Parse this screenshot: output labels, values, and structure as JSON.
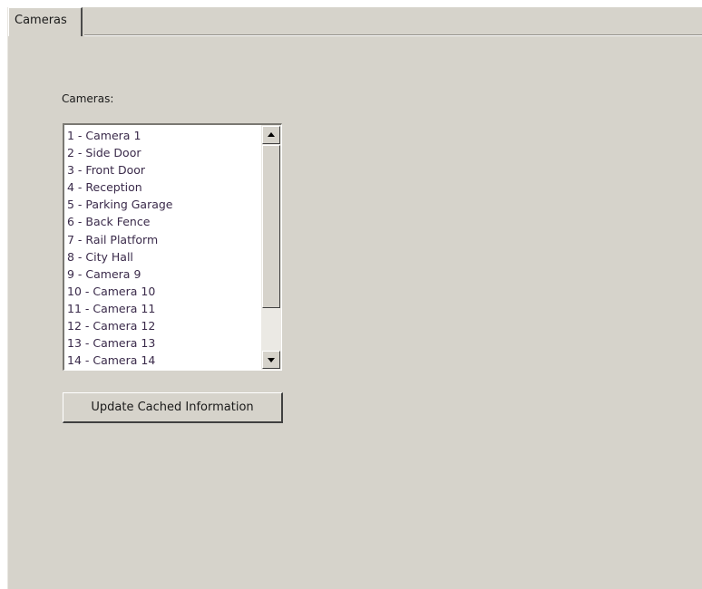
{
  "tabs": [
    {
      "label": "Cameras",
      "active": true
    }
  ],
  "panel": {
    "cameras_label": "Cameras:",
    "camera_list": [
      "1 - Camera 1",
      "2 - Side Door",
      "3 - Front Door",
      "4 - Reception",
      "5 - Parking Garage",
      "6 - Back Fence",
      "7 - Rail Platform",
      "8 - City Hall",
      "9 - Camera 9",
      "10 - Camera 10",
      "11 - Camera 11",
      "12 - Camera 12",
      "13 - Camera 13",
      "14 - Camera 14"
    ],
    "update_button_label": "Update Cached Information"
  },
  "colors": {
    "window_background": "#d6d3cb",
    "list_background": "#ffffff",
    "list_text": "#3a2a4a"
  },
  "icons": {
    "scroll_up": "triangle-up-icon",
    "scroll_down": "triangle-down-icon"
  }
}
